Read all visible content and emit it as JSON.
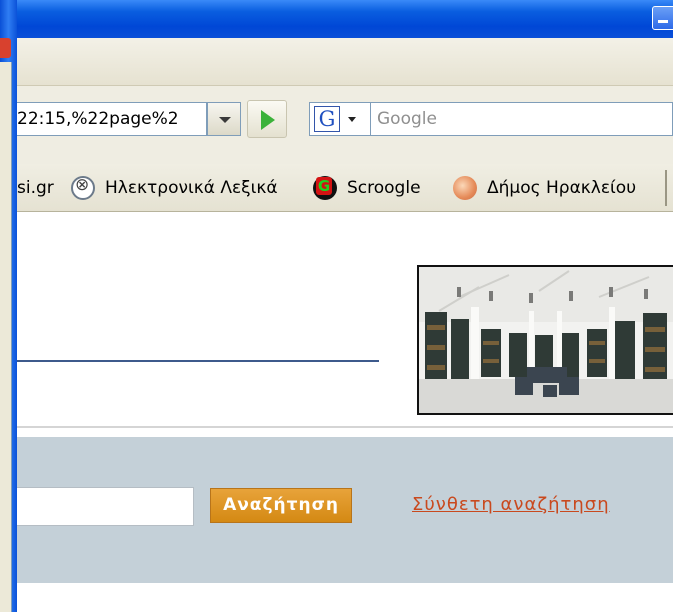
{
  "browser": {
    "address_bar": {
      "url_fragment": "22:15,%22page%2"
    },
    "search_box": {
      "engine_icon": "G",
      "placeholder": "Google"
    },
    "bookmarks": [
      {
        "label": "si.gr"
      },
      {
        "label": "Ηλεκτρονικά Λεξικά",
        "icon": "dictionary-icon"
      },
      {
        "label": "Scroogle",
        "icon": "scroogle-icon"
      },
      {
        "label": "Δήμος Ηρακλείου",
        "icon": "dimos-icon"
      }
    ]
  },
  "page": {
    "search": {
      "button_label": "Αναζήτηση",
      "advanced_link": "Σύνθετη αναζήτηση"
    }
  },
  "colors": {
    "titlebar": "#0a5ee0",
    "search_band": "#c4d0d8",
    "search_button": "#d48913",
    "advanced_link": "#c9491e",
    "header_rule": "#3d5a8c"
  }
}
